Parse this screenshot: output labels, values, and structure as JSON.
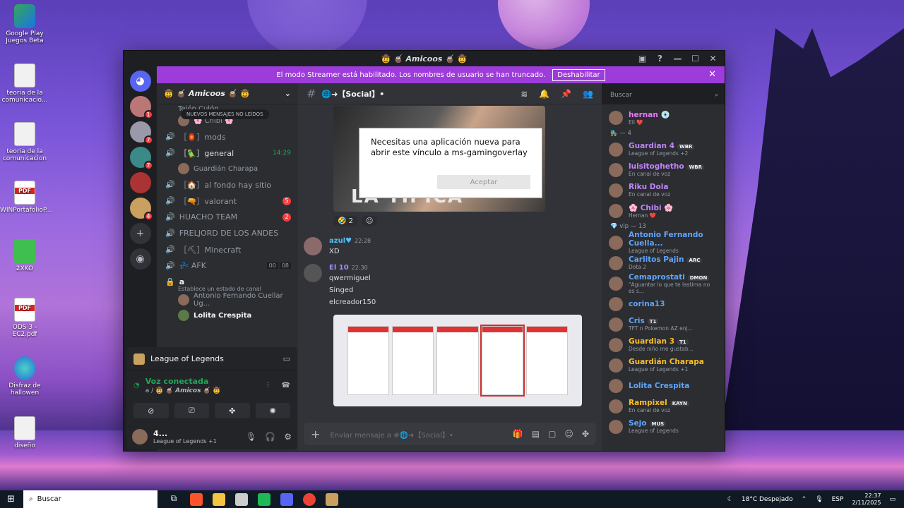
{
  "desktop": {
    "icons": [
      {
        "label": "Google Play Juegos Beta",
        "kind": "app"
      },
      {
        "label": "teoria de la comunicacio...",
        "kind": "doc"
      },
      {
        "label": "teoria de la comunicacion",
        "kind": "doc"
      },
      {
        "label": "WINPortafolioP...",
        "kind": "pdf"
      },
      {
        "label": "2XKO",
        "kind": "app"
      },
      {
        "label": "ODS 3 - EC2.pdf",
        "kind": "pdf"
      },
      {
        "label": "Disfraz de hallowen",
        "kind": "edge"
      },
      {
        "label": "diseño",
        "kind": "doc"
      }
    ]
  },
  "window": {
    "title": "🤠 🧉 𝘼𝙢𝙞𝙘𝙤𝙤𝙨 🧉 🤠",
    "streamer_banner": "El modo Streamer está habilitado. Los nombres de usuario se han truncado.",
    "streamer_button": "Deshabilitar"
  },
  "servers": [
    {
      "badge": "1"
    },
    {
      "badge": "7"
    },
    {
      "badge": "7"
    },
    {
      "badge": ""
    },
    {
      "badge": "4"
    }
  ],
  "sidebar": {
    "guild_name": "🤠 🧉 𝘼𝙢𝙞𝙘𝙤𝙤𝙨 🧉 🤠",
    "new_messages": "NUEVOS MENSAJES NO LEÍDOS",
    "top_users": [
      "Tejón Culón",
      "🌸 Chibi 🌸"
    ],
    "channels": [
      {
        "name": "［🏮］mods",
        "count": "",
        "time": ""
      },
      {
        "name": "［🦜］general",
        "count": "",
        "time": "14:29"
      },
      {
        "name": "［🏠］al fondo hay sitio",
        "count": "",
        "time": ""
      },
      {
        "name": "［🔫］valorant",
        "count": "5",
        "time": ""
      },
      {
        "name": "HUACHO TEAM",
        "count": "2",
        "time": ""
      },
      {
        "name": "FRELJORD DE LOS ANDES",
        "count": "",
        "time": ""
      },
      {
        "name": "［⛏］Minecraft",
        "count": "",
        "time": ""
      },
      {
        "name": "💤 AFK",
        "count": "",
        "time": ""
      }
    ],
    "general_member": "Guardián Charapa",
    "afk_counts": [
      "00",
      "08"
    ],
    "voice_channel": "a",
    "voice_status": "Establece un estado de canal",
    "voice_members": [
      "Antonio Fernando Cuellar Ug...",
      "Lolita Crespita"
    ]
  },
  "panel": {
    "activity": "League of Legends",
    "voice_title": "Voz conectada",
    "voice_sub": "a / 🤠 🧉 𝘼𝙢𝙞𝙘𝙤𝙨 🧉 🤠",
    "user_name": "4...",
    "user_status": "League of Legends +1"
  },
  "chat": {
    "channel": "🌐➜【Social】•",
    "image_caption": "LA TIPICA",
    "reaction_count": "2",
    "messages": [
      {
        "author": "azul♥",
        "time": "22:28",
        "color": "#4fc3f7",
        "lines": [
          "XD"
        ]
      },
      {
        "author": "El 10",
        "time": "22:30",
        "color": "#a78bfa",
        "lines": [
          "qwermiguel",
          "Singed",
          "elcreador150"
        ]
      }
    ],
    "composer_placeholder": "Enviar mensaje a #🌐➜【Social】•",
    "search_placeholder": "Buscar"
  },
  "dialog": {
    "text": "Necesitas una aplicación nueva para abrir este vínculo a ms-gamingoverlay",
    "button": "Aceptar"
  },
  "members": {
    "top": [
      {
        "name": "hernan 💿",
        "status": "Eli ❤️",
        "color": "#e879f9",
        "tag": ""
      }
    ],
    "group1_header": "🛼 — 4",
    "group1": [
      {
        "name": "Guardian 4",
        "status": "League of Legends +2",
        "color": "#c084fc",
        "tag": "WBR"
      },
      {
        "name": "luisitoghetho",
        "status": "En canal de voz",
        "color": "#c084fc",
        "tag": "WBR"
      },
      {
        "name": "Riku Dola",
        "status": "En canal de voz",
        "color": "#c084fc",
        "tag": ""
      },
      {
        "name": "🌸 Chibi 🌸",
        "status": "Hernan ❤️",
        "color": "#c084fc",
        "tag": ""
      }
    ],
    "group2_header": "💎 vip — 13",
    "group2": [
      {
        "name": "Antonio Fernando Cuella...",
        "status": "League of Legends",
        "color": "#60a5fa",
        "tag": ""
      },
      {
        "name": "Carlitos Pajin",
        "status": "Dota 2",
        "color": "#60a5fa",
        "tag": "ARC"
      },
      {
        "name": "Cemaprostati",
        "status": "\"Aguantar lo que te lastima no es s...",
        "color": "#60a5fa",
        "tag": "DMON"
      },
      {
        "name": "corina13",
        "status": "",
        "color": "#60a5fa",
        "tag": ""
      },
      {
        "name": "Cris",
        "status": "TFT n Pokemon AZ enj...",
        "color": "#60a5fa",
        "tag": "T1"
      },
      {
        "name": "Guardian 3",
        "status": "Desde niño me gustab...",
        "color": "#fbbf24",
        "tag": "T1"
      },
      {
        "name": "Guardián Charapa",
        "status": "League of Legends +1",
        "color": "#fbbf24",
        "tag": ""
      },
      {
        "name": "Lolita Crespita",
        "status": "",
        "color": "#60a5fa",
        "tag": ""
      },
      {
        "name": "Rampixel",
        "status": "En canal de voz",
        "color": "#fbbf24",
        "tag": "KAYN"
      },
      {
        "name": "Sejo",
        "status": "League of Legends",
        "color": "#60a5fa",
        "tag": "MUS"
      }
    ]
  },
  "taskbar": {
    "search": "Buscar",
    "weather": "18°C  Despejado",
    "lang": "ESP",
    "time": "22:37",
    "date": "2/11/2025"
  }
}
